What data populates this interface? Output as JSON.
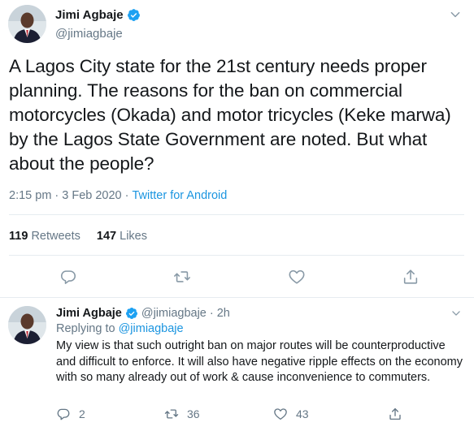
{
  "main_tweet": {
    "display_name": "Jimi Agbaje",
    "handle": "@jimiagbaje",
    "text": "A Lagos City state for the 21st century needs proper planning. The reasons for the ban on commercial motorcycles (Okada) and motor tricycles (Keke marwa) by the Lagos State Government are noted. But what about the people?",
    "time": "2:15 pm",
    "separator": "·",
    "date": "3 Feb 2020",
    "source": "Twitter for Android",
    "retweets_count": "119",
    "retweets_label": "Retweets",
    "likes_count": "147",
    "likes_label": "Likes"
  },
  "reply": {
    "display_name": "Jimi Agbaje",
    "handle": "@jimiagbaje",
    "separator": "·",
    "age": "2h",
    "replying_prefix": "Replying to",
    "replying_to": "@jimiagbaje",
    "text": "My view is that such outright ban on major routes will  be counterproductive and difficult to enforce. It will also have negative ripple effects on the economy with so many already out of work & cause inconvenience to commuters.",
    "reply_count": "2",
    "retweet_count": "36",
    "like_count": "43"
  },
  "colors": {
    "accent": "#1da1f2",
    "text": "#14171a",
    "muted": "#657786",
    "divider": "#e6ecf0"
  },
  "icons": [
    "verified-badge-icon",
    "chevron-down-icon",
    "reply-icon",
    "retweet-icon",
    "like-icon",
    "share-icon"
  ]
}
